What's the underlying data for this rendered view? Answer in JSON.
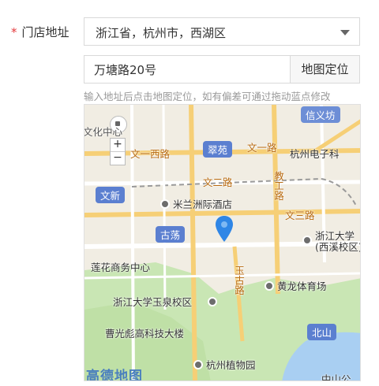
{
  "form": {
    "required_mark": "*",
    "store_address_label": "门店地址",
    "region_select_value": "浙江省，杭州市，西湖区",
    "address_input_value": "万塘路20号",
    "map_locate_button": "地图定位",
    "hint_text": "输入地址后点击地图定位，如有偏差可通过拖动蓝点修改"
  },
  "map": {
    "labels": {
      "xinyifang": "信义坊",
      "wenyi_west": "文一西路",
      "wenyi": "文一路",
      "cuiyuan": "翠苑",
      "hangzhou_electronic": "杭州电子科",
      "wenxin": "文新",
      "wener": "文二路",
      "jiaogong": "教工路",
      "milan_hotel": "米兰洲际酒店",
      "wensan": "文三路",
      "gudang": "古荡",
      "zju_xixi": "浙江大学(西溪校区)",
      "lianhua": "莲花商务中心",
      "yuquan_road": "玉古路",
      "huanglong": "黄龙体育场",
      "zju_yuquan": "浙江大学玉泉校区",
      "caoguangbiao": "曹光彪高科技大楼",
      "beishan": "北山",
      "botanical": "杭州植物园",
      "gushan": "古墩路",
      "wenyi_center": "文化中心",
      "zhongshan": "中山公",
      "logo": "高德地图"
    },
    "controls": {
      "zoom_in": "+",
      "zoom_out": "−"
    },
    "colors": {
      "land": "#f1ede3",
      "green": "#c9e6b4",
      "water": "#a9cff2",
      "road_main": "#f6cf76",
      "pin": "#2f86e6"
    }
  }
}
